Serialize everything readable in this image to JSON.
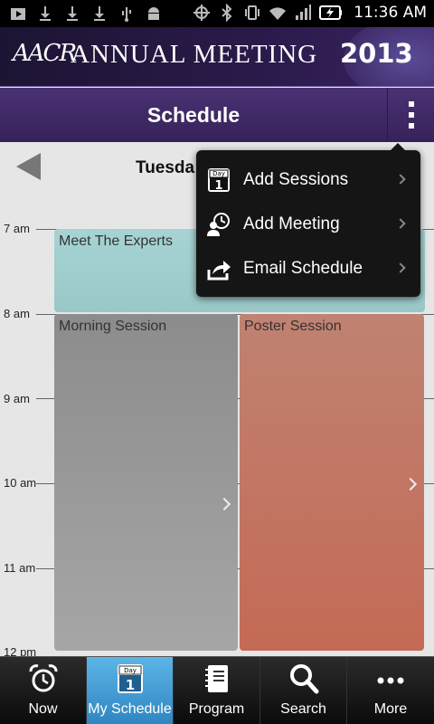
{
  "status_bar": {
    "time": "11:36 AM"
  },
  "banner": {
    "logo": "AACR",
    "title": "ANNUAL MEETING",
    "year": "2013"
  },
  "header": {
    "title": "Schedule"
  },
  "day_nav": {
    "day_label": "Tuesda"
  },
  "grid": {
    "hours": [
      "7 am",
      "8 am",
      "9 am",
      "10 am",
      "11 am",
      "12 pm"
    ]
  },
  "events": {
    "experts": "Meet The Experts",
    "morning": "Morning Session",
    "poster": "Poster Session"
  },
  "menu": {
    "items": [
      {
        "label": "Add Sessions",
        "icon": "calendar-day-icon",
        "icon_text_top": "Day",
        "icon_text_num": "1"
      },
      {
        "label": "Add Meeting",
        "icon": "add-meeting-icon"
      },
      {
        "label": "Email Schedule",
        "icon": "share-icon"
      }
    ]
  },
  "tabs": [
    {
      "label": "Now",
      "icon": "alarm-clock-icon"
    },
    {
      "label": "My Schedule",
      "icon": "calendar-day-icon",
      "icon_text_top": "Day",
      "icon_text_num": "1"
    },
    {
      "label": "Program",
      "icon": "notebook-icon"
    },
    {
      "label": "Search",
      "icon": "search-icon"
    },
    {
      "label": "More",
      "icon": "more-dots-icon"
    }
  ],
  "colors": {
    "header_purple": "#3e2866",
    "active_tab_blue": "#3d9bd6",
    "experts_teal": "#a0cccc",
    "morning_gray": "#999999",
    "poster_salmon": "#c2735f"
  }
}
